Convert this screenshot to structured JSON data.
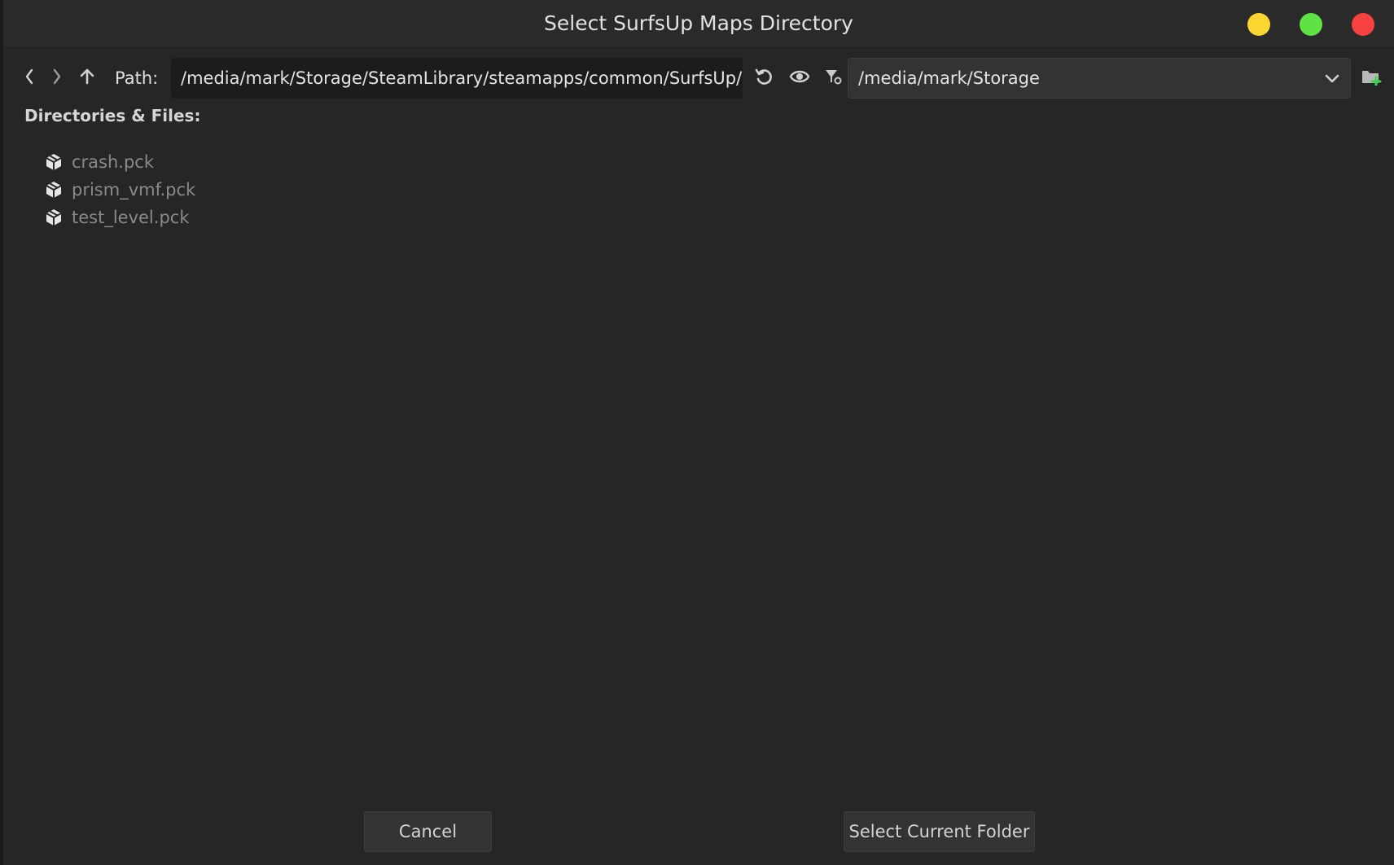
{
  "window": {
    "title": "Select SurfsUp Maps Directory",
    "controls": {
      "minimize_color": "#fcd630",
      "maximize_color": "#5fe243",
      "close_color": "#f74141"
    }
  },
  "toolbar": {
    "back_icon": "chevron-left-icon",
    "forward_icon": "chevron-right-icon",
    "up_icon": "arrow-up-icon",
    "path_label": "Path:",
    "path_value": "/media/mark/Storage/SteamLibrary/steamapps/common/SurfsUp/",
    "refresh_icon": "refresh-icon",
    "toggle_hidden_icon": "eye-icon",
    "filter_icon": "filter-icon",
    "drive_value": "/media/mark/Storage",
    "new_folder_icon": "new-folder-icon"
  },
  "browser": {
    "section_title": "Directories & Files:",
    "files": [
      {
        "name": "crash.pck",
        "icon": "package-icon"
      },
      {
        "name": "prism_vmf.pck",
        "icon": "package-icon"
      },
      {
        "name": "test_level.pck",
        "icon": "package-icon"
      }
    ]
  },
  "footer": {
    "cancel_label": "Cancel",
    "select_label": "Select Current Folder"
  }
}
